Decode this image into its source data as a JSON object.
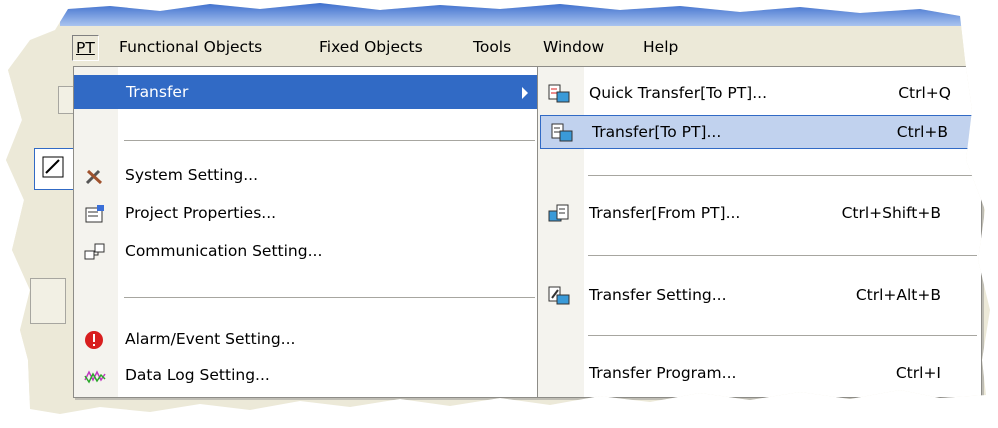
{
  "menubar": {
    "items": [
      {
        "label": "PT",
        "key": "P"
      },
      {
        "label": "Functional Objects",
        "key": "O"
      },
      {
        "label": "Fixed Objects",
        "key": "x"
      },
      {
        "label": "Tools",
        "key": "T"
      },
      {
        "label": "Window",
        "key": "W"
      },
      {
        "label": "Help",
        "key": "H"
      }
    ]
  },
  "pt_menu": {
    "items": [
      {
        "label": "Transfer",
        "icon": "none",
        "highlighted": true,
        "submenu": true
      },
      {
        "label": "System Setting...",
        "icon": "tools-icon"
      },
      {
        "label": "Project Properties...",
        "icon": "properties-icon"
      },
      {
        "label": "Communication Setting...",
        "icon": "network-icon"
      },
      {
        "label": "Alarm/Event Setting...",
        "icon": "alarm-icon"
      },
      {
        "label": "Data Log Setting...",
        "icon": "datalog-icon"
      }
    ]
  },
  "transfer_menu": {
    "items": [
      {
        "label": "Quick Transfer[To PT]...",
        "shortcut": "Ctrl+Q",
        "icon": "quick-transfer-icon"
      },
      {
        "label": "Transfer[To PT]...",
        "shortcut": "Ctrl+B",
        "icon": "transfer-to-pt-icon",
        "highlighted": true
      },
      {
        "label": "Transfer[From PT]...",
        "shortcut": "Ctrl+Shift+B",
        "icon": "transfer-from-pt-icon"
      },
      {
        "label": "Transfer Setting...",
        "shortcut": "Ctrl+Alt+B",
        "icon": "transfer-setting-icon"
      },
      {
        "label": "Transfer Program...",
        "shortcut": "Ctrl+I",
        "icon": "none"
      }
    ]
  },
  "colors": {
    "highlight_bg": "#c1d2ee",
    "highlight_border": "#316ac5",
    "menu_bg": "#ffffff",
    "chrome": "#ece9d8"
  }
}
